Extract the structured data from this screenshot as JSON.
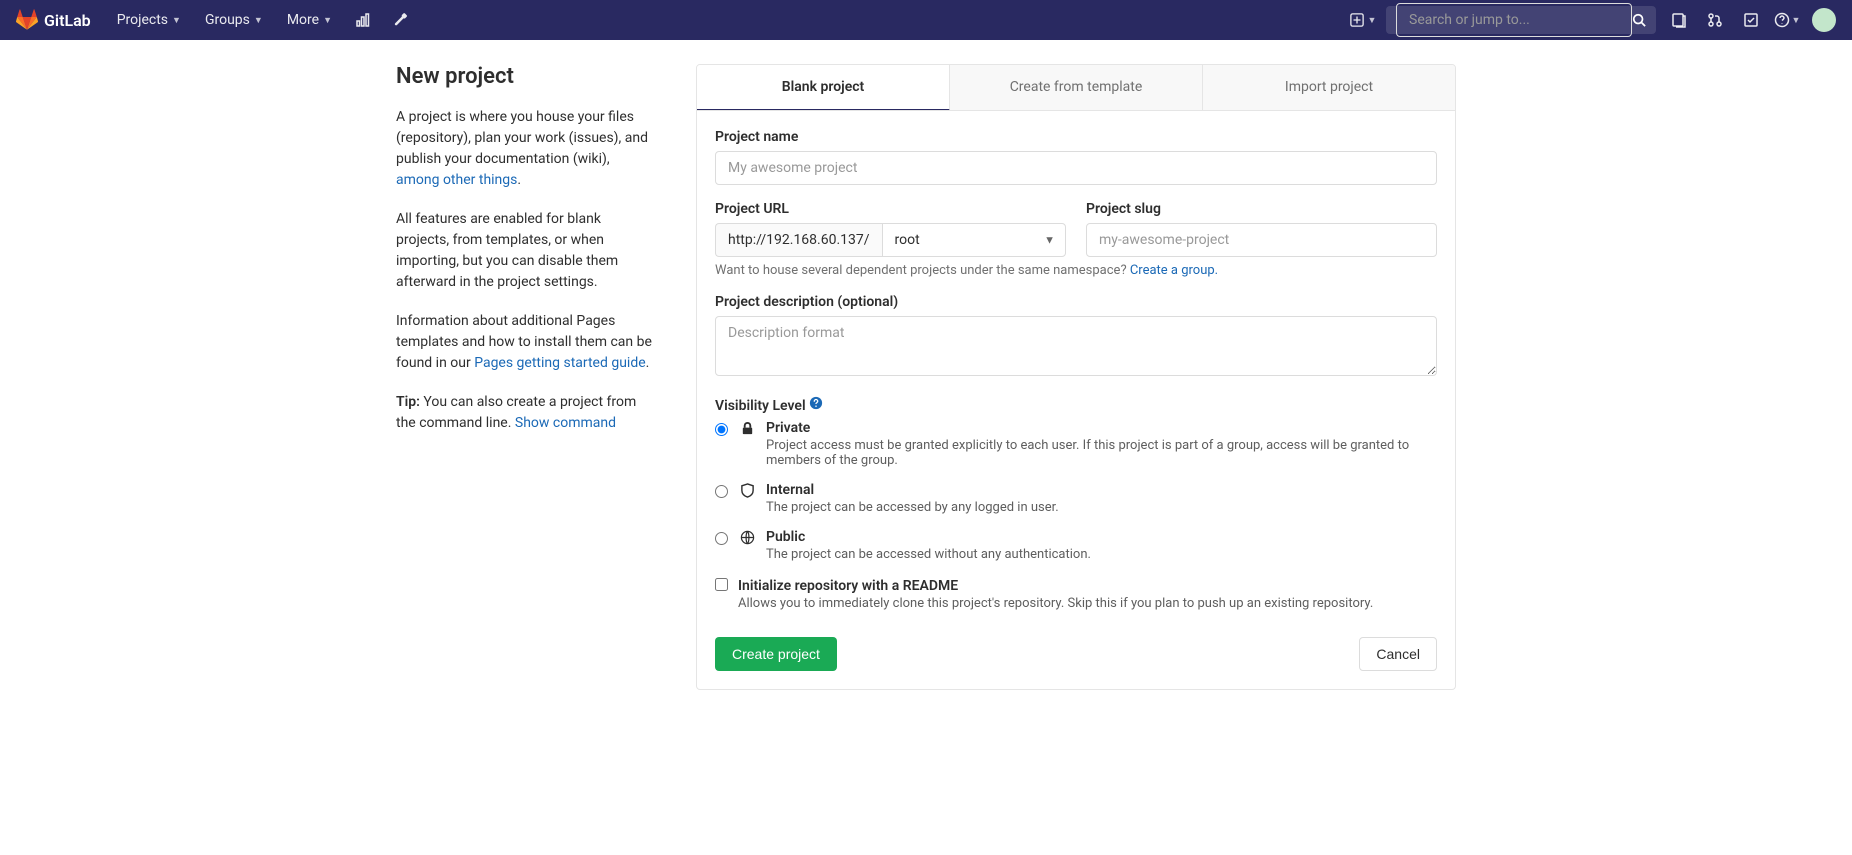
{
  "navbar": {
    "brand": "GitLab",
    "menus": {
      "projects": "Projects",
      "groups": "Groups",
      "more": "More"
    },
    "search_placeholder": "Search or jump to..."
  },
  "side": {
    "title": "New project",
    "p1a": "A project is where you house your files (repository), plan your work (issues), and publish your documentation (wiki), ",
    "p1_link": "among other things",
    "p1b": ".",
    "p2": "All features are enabled for blank projects, from templates, or when importing, but you can disable them afterward in the project settings.",
    "p3a": "Information about additional Pages templates and how to install them can be found in our ",
    "p3_link": "Pages getting started guide",
    "p3b": ".",
    "tip_label": "Tip:",
    "tip_text": " You can also create a project from the command line. ",
    "tip_link": "Show command"
  },
  "tabs": {
    "blank": "Blank project",
    "template": "Create from template",
    "import": "Import project"
  },
  "form": {
    "name_label": "Project name",
    "name_placeholder": "My awesome project",
    "url_label": "Project URL",
    "url_prefix": "http://192.168.60.137/",
    "url_namespace": "root",
    "slug_label": "Project slug",
    "slug_placeholder": "my-awesome-project",
    "namespace_help_a": "Want to house several dependent projects under the same namespace? ",
    "namespace_help_link": "Create a group.",
    "desc_label": "Project description (optional)",
    "desc_placeholder": "Description format",
    "vis_label": "Visibility Level",
    "vis_private_title": "Private",
    "vis_private_desc": "Project access must be granted explicitly to each user. If this project is part of a group, access will be granted to members of the group.",
    "vis_internal_title": "Internal",
    "vis_internal_desc": "The project can be accessed by any logged in user.",
    "vis_public_title": "Public",
    "vis_public_desc": "The project can be accessed without any authentication.",
    "readme_title": "Initialize repository with a README",
    "readme_desc": "Allows you to immediately clone this project's repository. Skip this if you plan to push up an existing repository.",
    "create_btn": "Create project",
    "cancel_btn": "Cancel"
  }
}
